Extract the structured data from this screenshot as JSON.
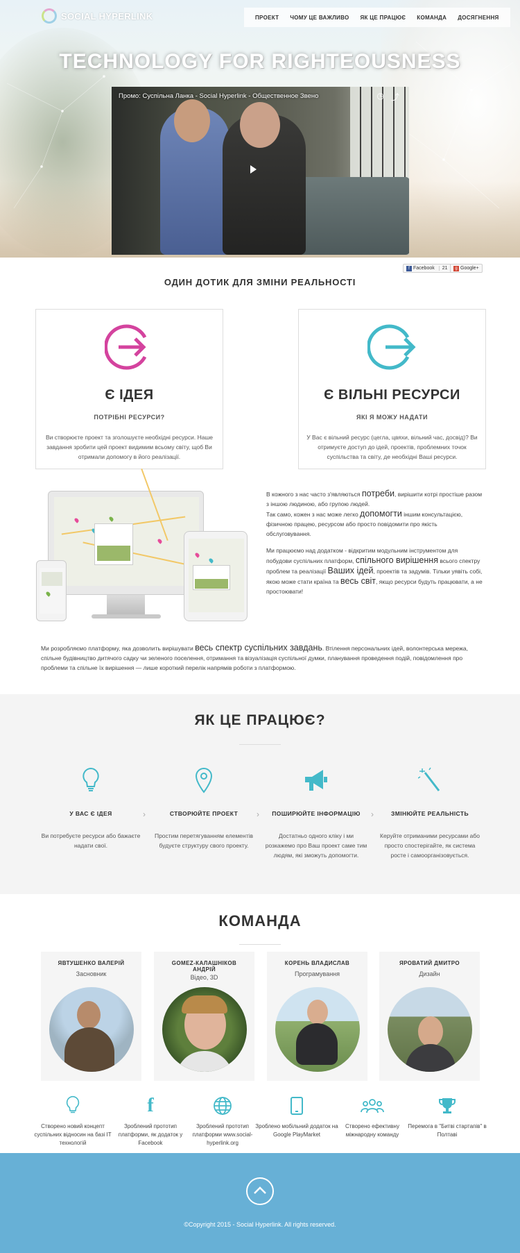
{
  "header": {
    "logo_text": "SOCIAL HYPERLINK",
    "nav": [
      "ПРОЕКТ",
      "ЧОМУ ЦЕ ВАЖЛИВО",
      "ЯК ЦЕ ПРАЦЮЄ",
      "КОМАНДА",
      "ДОСЯГНЕННЯ"
    ]
  },
  "hero": {
    "title": "TECHNOLOGY FOR RIGHTEOUSNESS",
    "video_title": "Промо: Суспільна Ланка - Social Hyperlink - Общественное Звено"
  },
  "share": {
    "facebook_label": "Facebook",
    "facebook_count": "21",
    "google_label": "Google+"
  },
  "intro": {
    "heading": "ОДИН ДОТИК ДЛЯ ЗМІНИ РЕАЛЬНОСТІ",
    "cards": [
      {
        "title": "Є ІДЕЯ",
        "subtitle": "ПОТРІБНІ РЕСУРСИ?",
        "text": "Ви створюєте проект та зголошуєте необхідні ресурси. Наше завдання зробити цей проект видимим всьому світу, щоб Ви отримали допомогу в його реалізації.",
        "color": "#d4439e"
      },
      {
        "title": "Є ВІЛЬНІ РЕСУРСИ",
        "subtitle": "ЯКІ Я МОЖУ НАДАТИ",
        "text": "У Вас є вільний ресурс (цегла, цвяхи, вільний час, досвід)? Ви отримуєте доступ до ідей, проектів, проблемних точок суспільства та світу, де необхідні Ваші ресурси.",
        "color": "#43b9c9"
      }
    ]
  },
  "about": {
    "p1_a": "В кожного з нас часто з'являються ",
    "p1_b": "потреби",
    "p1_c": ", вирішити котрі простіше разом з іншою людиною, або групою людей.",
    "p1_d": "Так само, кожен з нас може легко ",
    "p1_e": "допомогти",
    "p1_f": " іншим консультацією, фізичною працею, ресурсом або просто повідомити про якість обслуговування.",
    "p2_a": "Ми працюємо над додатком - відкритим модульним інструментом для побудови суспільних платформ, ",
    "p2_b": "спільного вирішення",
    "p2_c": " всього спектру проблем та реалізації ",
    "p2_d": "Ваших ідей",
    "p2_e": ", проектів та задумів. Тільки уявіть собі, якою може стати країна та ",
    "p2_f": "весь світ",
    "p2_g": ", якщо ресурси будуть працювати, а не простоювати!",
    "full_a": "Ми розробляємо платформу, яка дозволить вирішувати ",
    "full_b": "весь спектр суспільних завдань",
    "full_c": ". Втілення персональних ідей, волонтерська мережа, спільне будівництво дитячого садку чи зеленого поселення, отримання та візуалізація суспільної думки, планування проведення подій, повідомлення про проблеми та спільне їх вирішення — лише короткий перелік напрямів роботи з платформою."
  },
  "how": {
    "heading": "ЯК ЦЕ ПРАЦЮЄ?",
    "steps": [
      {
        "icon": "lightbulb-icon",
        "title": "У ВАС Є ІДЕЯ",
        "text": "Ви потребуєте ресурси або бажаєте надати свої."
      },
      {
        "icon": "map-pin-icon",
        "title": "СТВОРЮЙТЕ ПРОЕКТ",
        "text": "Простим перетягуванням елементів будуєте структуру свого проекту."
      },
      {
        "icon": "megaphone-icon",
        "title": "ПОШИРЮЙТЕ ІНФОРМАЦІЮ",
        "text": "Достатньо одного кліку і ми розкажемо про Ваш проект саме тим людям, які зможуть допомогти."
      },
      {
        "icon": "magic-wand-icon",
        "title": "ЗМІНЮЙТЕ РЕАЛЬНІСТЬ",
        "text": "Керуйте отриманими ресурсами або просто спостерігайте, як система росте і самоорганізовується."
      }
    ]
  },
  "team": {
    "heading": "КОМАНДА",
    "members": [
      {
        "name": "ЯВТУШЕНКО ВАЛЕРІЙ",
        "role": "Засновник"
      },
      {
        "name": "GOMEZ-КАЛАШНІКОВ АНДРІЙ",
        "role": "Відео, 3D"
      },
      {
        "name": "КОРЕНЬ ВЛАДИСЛАВ",
        "role": "Програмування"
      },
      {
        "name": "ЯРОВАТИЙ ДМИТРО",
        "role": "Дизайн"
      }
    ]
  },
  "achievements": [
    {
      "icon": "lightbulb-icon",
      "text": "Створено новий концепт суспільних відносин на базі IT технологій"
    },
    {
      "icon": "facebook-icon",
      "text": "Зроблений прототип платформи, як додаток у Facebook"
    },
    {
      "icon": "globe-icon",
      "text": "Зроблений прототип платформи www.social-hyperlink.org"
    },
    {
      "icon": "tablet-icon",
      "text": "Зроблено мобільний додаток на Google PlayMarket"
    },
    {
      "icon": "team-icon",
      "text": "Створено ефективну міжнародну команду"
    },
    {
      "icon": "trophy-icon",
      "text": "Перемога в \"Битві стартапів\" в Полтаві"
    }
  ],
  "footer": {
    "copyright": "©Copyright 2015 - Social Hyperlink. All rights reserved."
  },
  "colors": {
    "accent_teal": "#43b9c9",
    "accent_pink": "#d4439e",
    "footer_blue": "#67b0d6"
  }
}
